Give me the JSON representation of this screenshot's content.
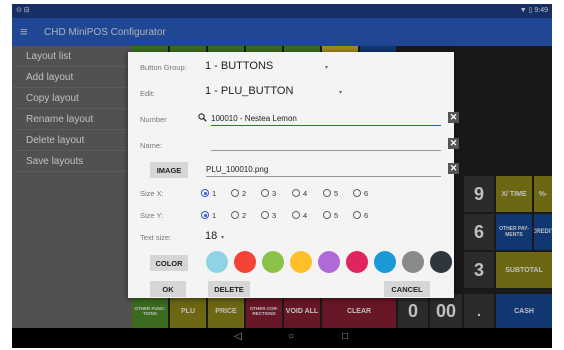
{
  "status_bar": {
    "left_icons": "⊙ ⊟",
    "right_text": "▼ ▯ 9:49"
  },
  "app_bar": {
    "menu_icon": "≡",
    "title": "CHD MiniPOS Configurator"
  },
  "sidebar": {
    "items": [
      {
        "label": "Layout list"
      },
      {
        "label": "Add layout"
      },
      {
        "label": "Copy layout"
      },
      {
        "label": "Rename layout"
      },
      {
        "label": "Delete layout"
      },
      {
        "label": "Save layouts"
      }
    ]
  },
  "keypad": {
    "visible_keys": [
      {
        "label": "9"
      },
      {
        "label": "X/ TIME"
      },
      {
        "label": "%-"
      },
      {
        "label": "6"
      },
      {
        "label": "OTHER PAY-MENTS"
      },
      {
        "label": "CREDIT"
      },
      {
        "label": "3"
      },
      {
        "label": "SUBTOTAL"
      },
      {
        "label": "OTHER FUNC-TIONS"
      },
      {
        "label": "PLU"
      },
      {
        "label": "PRICE"
      },
      {
        "label": "OTHER COR-RECTIONS"
      },
      {
        "label": "VOID ALL"
      },
      {
        "label": "CLEAR"
      },
      {
        "label": "0"
      },
      {
        "label": "00"
      },
      {
        "label": "."
      },
      {
        "label": "CASH"
      }
    ],
    "colors": {
      "green": "#4f8f2a",
      "olive": "#8f8a18",
      "red": "#8a1f33",
      "dark": "#3a3a3a",
      "blue": "#174a9a",
      "yellow": "#d9b82c"
    }
  },
  "dialog": {
    "button_group": {
      "label": "Button Group:",
      "value": "1 - BUTTONS",
      "caret": "▾"
    },
    "edit": {
      "label": "Edit:",
      "value": "1 - PLU_BUTTON",
      "caret": "▾"
    },
    "number": {
      "label": "Number",
      "value": "100010 - Nestea Lemon",
      "clear": "✕",
      "search_icon": "magnifier"
    },
    "name": {
      "label": "Name:",
      "value": "",
      "clear": "✕"
    },
    "image": {
      "button_label": "IMAGE",
      "value": "PLU_100010.png",
      "clear": "✕"
    },
    "size_x": {
      "label": "Size X:",
      "options": [
        "1",
        "2",
        "3",
        "4",
        "5",
        "6"
      ],
      "selected": "1"
    },
    "size_y": {
      "label": "Size Y:",
      "options": [
        "1",
        "2",
        "3",
        "4",
        "5",
        "6"
      ],
      "selected": "1"
    },
    "text_size": {
      "label": "Text size:",
      "value": "18",
      "caret": "▾"
    },
    "color": {
      "button_label": "COLOR",
      "swatches": [
        "#8fd3e6",
        "#f44336",
        "#8bc34a",
        "#ffc02a",
        "#b06ad8",
        "#e0245e",
        "#1a9ad6",
        "#8a8a8a",
        "#2f363d"
      ]
    },
    "actions": {
      "ok": "OK",
      "delete": "DELETE",
      "cancel": "CANCEL"
    }
  },
  "nav_bar": {
    "back": "◁",
    "home": "○",
    "recents": "□"
  }
}
